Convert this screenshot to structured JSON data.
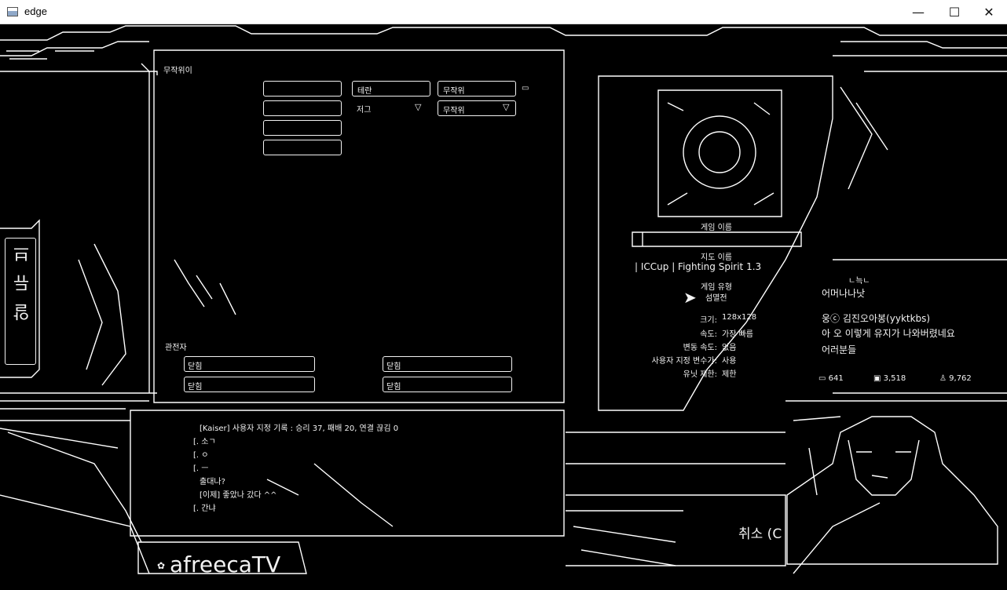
{
  "window": {
    "title": "edge",
    "minimize_glyph": "—",
    "maximize_glyph": "☐",
    "close_glyph": "✕"
  },
  "game_lobby": {
    "section_title": "무작위이",
    "player_slots": [
      "",
      "",
      "",
      ""
    ],
    "options": [
      {
        "label": "테란",
        "value": "무작위"
      },
      {
        "label": "저그",
        "value": "무작위"
      }
    ],
    "observer_label": "관전자",
    "observer_slots": [
      "닫힘",
      "닫힘",
      "닫힘",
      "닫힘"
    ],
    "side_tab": "알 듀 브"
  },
  "lobby_chat": {
    "lines": [
      "[Kaiser] 사용자 지정 기록 : 승리 37, 패배 20, 연결 끊김 0",
      "[. 소ㄱ",
      "[. ㅇ",
      "[. ㅡ",
      "출대나?",
      "[이제] 좋았나 갔다 ^^",
      "[. 간냐"
    ]
  },
  "game_info": {
    "game_name_label": "게임 이름",
    "game_name_value": "",
    "map_name_label": "지도 이름",
    "map_name_value": "| ICCup | Fighting Spirit 1.3",
    "game_type_label": "게임 유형",
    "game_type_value": "섬멸전",
    "details": [
      {
        "label": "크기:",
        "value": "128x128"
      },
      {
        "label": "속도:",
        "value": "가장 빠름"
      },
      {
        "label": "변동 속도:",
        "value": "없음"
      },
      {
        "label": "사용자 지정 변수가:",
        "value": "사용"
      },
      {
        "label": "유닛 제한:",
        "value": "제한"
      }
    ]
  },
  "stream_chat": {
    "header": "ㄴ늑ㄴ",
    "messages": [
      "어머나나낫",
      "웅ⓒ 김진오아봉(yyktkbs)",
      "아 오 이렇게 유지가 나와버렸네요",
      "어러분들"
    ],
    "stats": [
      {
        "icon": "chat-icon",
        "value": "641"
      },
      {
        "icon": "screen-icon",
        "value": "3,518"
      },
      {
        "icon": "viewer-icon",
        "value": "9,762"
      }
    ]
  },
  "cancel_button": "취소 (C",
  "broadcaster_logo": "afreecaTV",
  "colors": {
    "edge_line": "#ffffff",
    "background": "#000000",
    "titlebar": "#ffffff"
  }
}
